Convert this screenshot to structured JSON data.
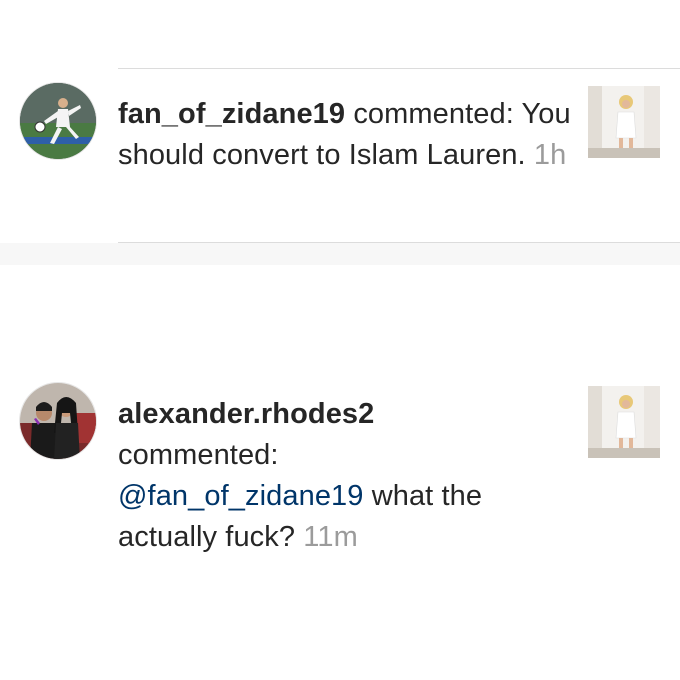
{
  "notifications": [
    {
      "username": "fan_of_zidane19",
      "action": "commented:",
      "comment": "You should convert to Islam Lauren.",
      "time": "1h",
      "avatar_icon": "soccer-player-avatar",
      "thumbnail_icon": "post-thumbnail-photo"
    },
    {
      "username": "alexander.rhodes2",
      "action": "commented:",
      "mention": "@fan_of_zidane19",
      "comment": "what the actually fuck?",
      "time": "11m",
      "avatar_icon": "two-people-avatar",
      "thumbnail_icon": "post-thumbnail-photo"
    }
  ],
  "colors": {
    "text": "#262626",
    "mention": "#003569",
    "timestamp": "#9b9b9b",
    "divider": "#dcdcdc"
  }
}
